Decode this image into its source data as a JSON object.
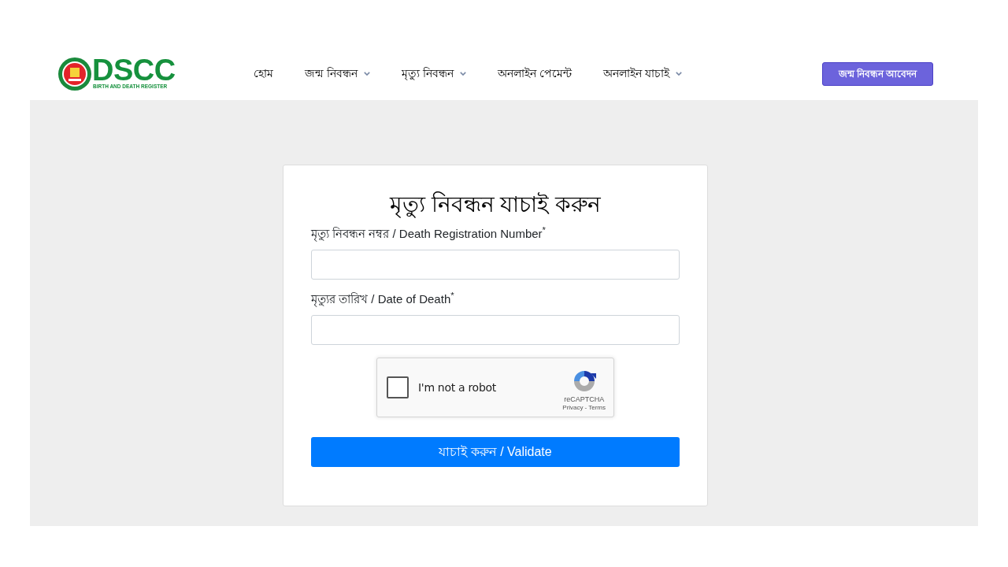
{
  "header": {
    "logo": {
      "title": "DSCC",
      "subtitle": "BIRTH AND DEATH REGISTER"
    },
    "nav": [
      {
        "label": "হোম",
        "dropdown": false
      },
      {
        "label": "জন্ম নিবন্ধন",
        "dropdown": true
      },
      {
        "label": "মৃত্যু নিবন্ধন",
        "dropdown": true
      },
      {
        "label": "অনলাইন পেমেন্ট",
        "dropdown": false
      },
      {
        "label": "অনলাইন যাচাই",
        "dropdown": true
      }
    ],
    "action_button": "জন্ম নিবন্ধন আবেদন"
  },
  "form": {
    "title": "মৃত্যু নিবন্ধন যাচাই করুন",
    "fields": [
      {
        "label": "মৃত্যু নিবন্ধন নম্বর / Death Registration Number$^{*}$"
      },
      {
        "label": "মৃত্যুর তারিখ / Date of Death$^{*}$"
      }
    ],
    "captcha": {
      "label": "I'm not a robot",
      "checked": false,
      "brand": "reCAPTCHA",
      "links": [
        "Privacy",
        "Terms"
      ],
      "separator": "-"
    },
    "submit": "যাচাই করুন / Validate"
  }
}
